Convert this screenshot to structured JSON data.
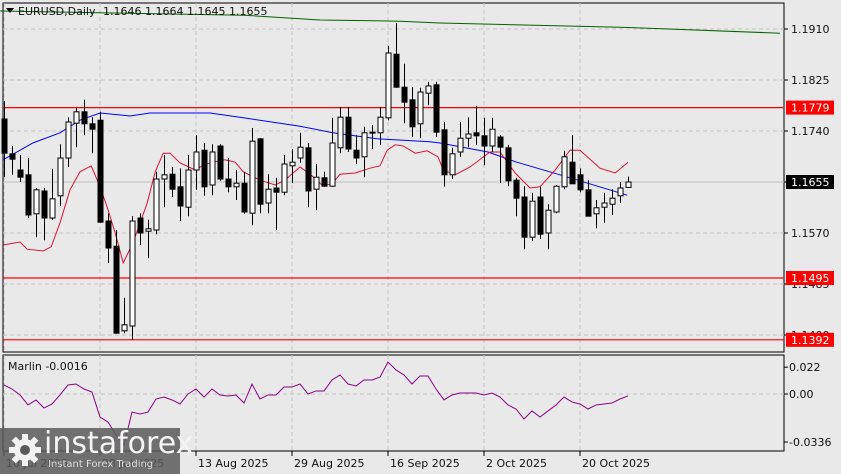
{
  "header": {
    "symbol": "EURUSD,Daily",
    "ohlc": "1.1646 1.1664 1.1645 1.1655"
  },
  "price_axis": {
    "ticks": [
      "1.1910",
      "1.1825",
      "1.1740",
      "1.1655",
      "1.1570",
      "1.1485",
      "1.1400"
    ],
    "tick_values": [
      1.191,
      1.1825,
      1.174,
      1.1655,
      1.157,
      1.1485,
      1.14
    ]
  },
  "current_price": {
    "label": "1.1655",
    "value": 1.1655,
    "color": "#000000"
  },
  "levels": [
    {
      "label": "1.1779",
      "value": 1.1779,
      "color": "#ff0000"
    },
    {
      "label": "1.1495",
      "value": 1.1495,
      "color": "#ff0000"
    },
    {
      "label": "1.1392",
      "value": 1.1392,
      "color": "#ff0000"
    }
  ],
  "time_axis": [
    {
      "label": "10 Jul 2025",
      "index": 0
    },
    {
      "label": "28 Jul 2025",
      "index": 12
    },
    {
      "label": "13 Aug 2025",
      "index": 24
    },
    {
      "label": "29 Aug 2025",
      "index": 36
    },
    {
      "label": "16 Sep 2025",
      "index": 48
    },
    {
      "label": "2 Oct 2025",
      "index": 60
    },
    {
      "label": "20 Oct 2025",
      "index": 72
    }
  ],
  "indicator": {
    "title": "Marlin -0.0016",
    "ticks": [
      "0.022",
      "0.00",
      "-0.0336"
    ],
    "tick_values": [
      0.022,
      0,
      -0.0336
    ],
    "color": "#8b008b"
  },
  "colors": {
    "ma_fast": "#e0103a",
    "ma_slow": "#0000ff",
    "ma_long": "#006400",
    "grid": "#c4c4c4"
  },
  "watermark": {
    "brand": "instaforex",
    "tagline": "Instant Forex Trading"
  },
  "chart_data": {
    "type": "candlestick",
    "title": "EURUSD,Daily",
    "ylim": [
      1.138,
      1.195
    ],
    "ohlc": [
      [
        1.176,
        1.179,
        1.1663,
        1.1703
      ],
      [
        1.1702,
        1.1715,
        1.1667,
        1.1693
      ],
      [
        1.1675,
        1.17,
        1.1655,
        1.1663
      ],
      [
        1.1667,
        1.1695,
        1.1595,
        1.16
      ],
      [
        1.1602,
        1.1645,
        1.1563,
        1.1642
      ],
      [
        1.164,
        1.1645,
        1.1558,
        1.1595
      ],
      [
        1.1595,
        1.1677,
        1.1592,
        1.1627
      ],
      [
        1.1632,
        1.1718,
        1.1615,
        1.1695
      ],
      [
        1.1695,
        1.1763,
        1.168,
        1.1755
      ],
      [
        1.1753,
        1.1778,
        1.1713,
        1.1772
      ],
      [
        1.1772,
        1.1792,
        1.1733,
        1.1752
      ],
      [
        1.1752,
        1.1763,
        1.1703,
        1.1743
      ],
      [
        1.1758,
        1.1772,
        1.1587,
        1.1588
      ],
      [
        1.159,
        1.1603,
        1.152,
        1.1545
      ],
      [
        1.1548,
        1.1575,
        1.1402,
        1.1403
      ],
      [
        1.1407,
        1.1462,
        1.1403,
        1.1417
      ],
      [
        1.1415,
        1.1598,
        1.1392,
        1.159
      ],
      [
        1.1595,
        1.1603,
        1.155,
        1.157
      ],
      [
        1.1573,
        1.1592,
        1.1528,
        1.1577
      ],
      [
        1.1575,
        1.1672,
        1.1568,
        1.166
      ],
      [
        1.166,
        1.17,
        1.1613,
        1.1667
      ],
      [
        1.1668,
        1.168,
        1.163,
        1.1643
      ],
      [
        1.1647,
        1.1678,
        1.159,
        1.1615
      ],
      [
        1.1613,
        1.17,
        1.1598,
        1.1675
      ],
      [
        1.1675,
        1.1733,
        1.1642,
        1.1705
      ],
      [
        1.1708,
        1.172,
        1.1632,
        1.1647
      ],
      [
        1.165,
        1.1718,
        1.1633,
        1.1705
      ],
      [
        1.1715,
        1.1718,
        1.1657,
        1.166
      ],
      [
        1.166,
        1.1695,
        1.1638,
        1.1647
      ],
      [
        1.1647,
        1.1675,
        1.1625,
        1.1653
      ],
      [
        1.1653,
        1.1672,
        1.1602,
        1.1605
      ],
      [
        1.1603,
        1.1745,
        1.1583,
        1.1723
      ],
      [
        1.1727,
        1.1728,
        1.1603,
        1.1618
      ],
      [
        1.162,
        1.1668,
        1.1603,
        1.1643
      ],
      [
        1.1645,
        1.1662,
        1.1575,
        1.1638
      ],
      [
        1.1638,
        1.17,
        1.1633,
        1.1685
      ],
      [
        1.1682,
        1.171,
        1.1653,
        1.1688
      ],
      [
        1.1695,
        1.1737,
        1.1687,
        1.1713
      ],
      [
        1.1712,
        1.172,
        1.1613,
        1.164
      ],
      [
        1.1643,
        1.1685,
        1.1608,
        1.1663
      ],
      [
        1.1662,
        1.1672,
        1.1647,
        1.1648
      ],
      [
        1.1648,
        1.1762,
        1.1647,
        1.172
      ],
      [
        1.1712,
        1.178,
        1.1703,
        1.1763
      ],
      [
        1.1763,
        1.178,
        1.1705,
        1.171
      ],
      [
        1.1708,
        1.1733,
        1.1685,
        1.1695
      ],
      [
        1.1697,
        1.1747,
        1.1663,
        1.1737
      ],
      [
        1.1737,
        1.175,
        1.171,
        1.1738
      ],
      [
        1.1737,
        1.178,
        1.1717,
        1.1763
      ],
      [
        1.1762,
        1.1882,
        1.1758,
        1.187
      ],
      [
        1.1868,
        1.192,
        1.1812,
        1.1813
      ],
      [
        1.1813,
        1.1852,
        1.1753,
        1.1788
      ],
      [
        1.1792,
        1.1813,
        1.173,
        1.1747
      ],
      [
        1.1752,
        1.1812,
        1.1728,
        1.1805
      ],
      [
        1.1803,
        1.1822,
        1.1783,
        1.1815
      ],
      [
        1.1817,
        1.1822,
        1.173,
        1.1738
      ],
      [
        1.1742,
        1.1755,
        1.1647,
        1.1667
      ],
      [
        1.1667,
        1.1712,
        1.166,
        1.1702
      ],
      [
        1.1705,
        1.1755,
        1.1697,
        1.1728
      ],
      [
        1.1728,
        1.1763,
        1.1713,
        1.1735
      ],
      [
        1.1737,
        1.1782,
        1.1717,
        1.1732
      ],
      [
        1.1732,
        1.1762,
        1.1683,
        1.1715
      ],
      [
        1.1715,
        1.1762,
        1.1705,
        1.1743
      ],
      [
        1.173,
        1.1733,
        1.1653,
        1.1713
      ],
      [
        1.1712,
        1.1717,
        1.1648,
        1.1657
      ],
      [
        1.1658,
        1.1662,
        1.1598,
        1.1628
      ],
      [
        1.163,
        1.1648,
        1.1543,
        1.1563
      ],
      [
        1.1563,
        1.1637,
        1.1557,
        1.1623
      ],
      [
        1.163,
        1.1647,
        1.156,
        1.1568
      ],
      [
        1.157,
        1.1618,
        1.1543,
        1.1608
      ],
      [
        1.1605,
        1.165,
        1.1603,
        1.1648
      ],
      [
        1.1647,
        1.1707,
        1.1643,
        1.1697
      ],
      [
        1.1688,
        1.1733,
        1.1652,
        1.1652
      ],
      [
        1.1667,
        1.1678,
        1.1638,
        1.1642
      ],
      [
        1.1642,
        1.1658,
        1.1598,
        1.1598
      ],
      [
        1.1602,
        1.1625,
        1.1578,
        1.1612
      ],
      [
        1.1613,
        1.1637,
        1.1587,
        1.162
      ],
      [
        1.1618,
        1.1643,
        1.16,
        1.1628
      ],
      [
        1.1632,
        1.1655,
        1.162,
        1.1645
      ],
      [
        1.1646,
        1.1664,
        1.1645,
        1.1655
      ]
    ],
    "ma_fast": [
      [
        -0.1,
        1.155
      ],
      [
        2,
        1.1555
      ],
      [
        2.9,
        1.1543
      ],
      [
        4.9,
        1.154
      ],
      [
        5.9,
        1.1547
      ],
      [
        7,
        1.1587
      ],
      [
        8.25,
        1.1642
      ],
      [
        9.5,
        1.1672
      ],
      [
        10.9,
        1.1682
      ],
      [
        12,
        1.1647
      ],
      [
        12.9,
        1.1613
      ],
      [
        13.9,
        1.157
      ],
      [
        14.9,
        1.152
      ],
      [
        16.1,
        1.1553
      ],
      [
        17.9,
        1.162
      ],
      [
        18.9,
        1.1672
      ],
      [
        19.9,
        1.1703
      ],
      [
        20.75,
        1.1703
      ],
      [
        22,
        1.1687
      ],
      [
        23.9,
        1.1675
      ],
      [
        24.9,
        1.1683
      ],
      [
        26.1,
        1.1688
      ],
      [
        27.6,
        1.1692
      ],
      [
        28.9,
        1.1688
      ],
      [
        29.9,
        1.1672
      ],
      [
        32,
        1.1658
      ],
      [
        33.9,
        1.165
      ],
      [
        35.1,
        1.1658
      ],
      [
        37,
        1.168
      ],
      [
        38.25,
        1.1668
      ],
      [
        39.9,
        1.1648
      ],
      [
        41.1,
        1.1653
      ],
      [
        42,
        1.1668
      ],
      [
        43.9,
        1.167
      ],
      [
        45.75,
        1.1678
      ],
      [
        47,
        1.1682
      ],
      [
        47.9,
        1.1708
      ],
      [
        48.9,
        1.1717
      ],
      [
        49.9,
        1.1715
      ],
      [
        51.4,
        1.1703
      ],
      [
        52.9,
        1.1707
      ],
      [
        54.25,
        1.1697
      ],
      [
        54.9,
        1.1675
      ],
      [
        56.4,
        1.1667
      ],
      [
        58.25,
        1.168
      ],
      [
        60.75,
        1.1705
      ],
      [
        62,
        1.1705
      ],
      [
        63.9,
        1.167
      ],
      [
        65.75,
        1.1645
      ],
      [
        67,
        1.1647
      ],
      [
        68.9,
        1.1675
      ],
      [
        70.75,
        1.1708
      ],
      [
        72,
        1.1708
      ],
      [
        74.5,
        1.1678
      ],
      [
        76.4,
        1.167
      ],
      [
        78,
        1.1688
      ]
    ],
    "ma_slow": [
      [
        -0.1,
        1.1692
      ],
      [
        3.6,
        1.172
      ],
      [
        7,
        1.1737
      ],
      [
        9.5,
        1.1758
      ],
      [
        12,
        1.177
      ],
      [
        15.75,
        1.1765
      ],
      [
        18.25,
        1.177
      ],
      [
        25.75,
        1.177
      ],
      [
        29.9,
        1.1762
      ],
      [
        37,
        1.1748
      ],
      [
        41.1,
        1.1737
      ],
      [
        46.6,
        1.1727
      ],
      [
        53.25,
        1.1722
      ],
      [
        54.5,
        1.172
      ],
      [
        60.5,
        1.1705
      ],
      [
        64.1,
        1.1688
      ],
      [
        69.5,
        1.1667
      ],
      [
        77.9,
        1.1633
      ]
    ],
    "ma_long": [
      [
        -0.5,
        1.194
      ],
      [
        12,
        1.1937
      ],
      [
        30,
        1.1933
      ],
      [
        39.5,
        1.1925
      ],
      [
        49.5,
        1.1923
      ],
      [
        54.5,
        1.192
      ],
      [
        77,
        1.1913
      ],
      [
        97,
        1.1903
      ]
    ],
    "marlin": [
      0.0074,
      0.0041,
      -0.0008,
      -0.009,
      -0.0049,
      -0.0115,
      -0.0082,
      -0.0008,
      0.0074,
      0.0082,
      0.0041,
      0.0016,
      -0.0189,
      -0.023,
      -0.0336,
      -0.0418,
      -0.0148,
      -0.0164,
      -0.0148,
      -0.0041,
      -0.0025,
      -0.0049,
      -0.0082,
      0.0,
      0.0041,
      -0.0025,
      0.0041,
      -0.0008,
      -0.0016,
      -0.0008,
      -0.0074,
      0.0082,
      -0.0041,
      -0.0008,
      -0.0008,
      0.0057,
      0.0057,
      0.0082,
      0.0,
      0.0025,
      0.0025,
      0.0115,
      0.0156,
      0.0082,
      0.0066,
      0.0115,
      0.0115,
      0.0139,
      0.0262,
      0.0197,
      0.0156,
      0.0082,
      0.0148,
      0.0148,
      0.0041,
      -0.0049,
      -0.0008,
      0.0008,
      0.0008,
      0.0008,
      -0.0008,
      0.0008,
      -0.0025,
      -0.009,
      -0.0123,
      -0.0205,
      -0.0139,
      -0.0189,
      -0.0139,
      -0.009,
      -0.0025,
      -0.0066,
      -0.0082,
      -0.0123,
      -0.009,
      -0.0082,
      -0.0074,
      -0.0041,
      -0.0016
    ]
  }
}
